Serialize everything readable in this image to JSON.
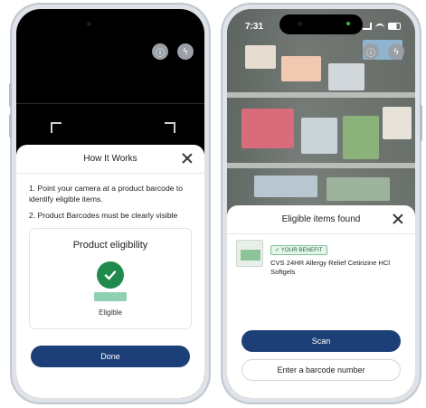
{
  "left_phone": {
    "sheet_title": "How It Works",
    "steps": [
      "1. Point your camera at a product barcode to identify eligible items.",
      "2. Product Barcodes must be clearly visible"
    ],
    "card": {
      "title": "Product eligibility",
      "status_label": "Eligible"
    },
    "done_label": "Done"
  },
  "right_phone": {
    "status_time": "7:31",
    "sheet_title": "Eligible items found",
    "product": {
      "benefit_badge": "✓ YOUR BENEFIT",
      "name": "CVS 24HR Allergy Relief Cetirizine HCl Softgels"
    },
    "scan_label": "Scan",
    "barcode_label": "Enter a barcode number"
  },
  "icons": {
    "info": "info-icon",
    "flash_off": "flash-off-icon",
    "close": "close-icon",
    "check": "checkmark-icon"
  },
  "colors": {
    "primary": "#1d3f77",
    "success": "#1f8a4c",
    "success_light": "#8fcfb2"
  }
}
